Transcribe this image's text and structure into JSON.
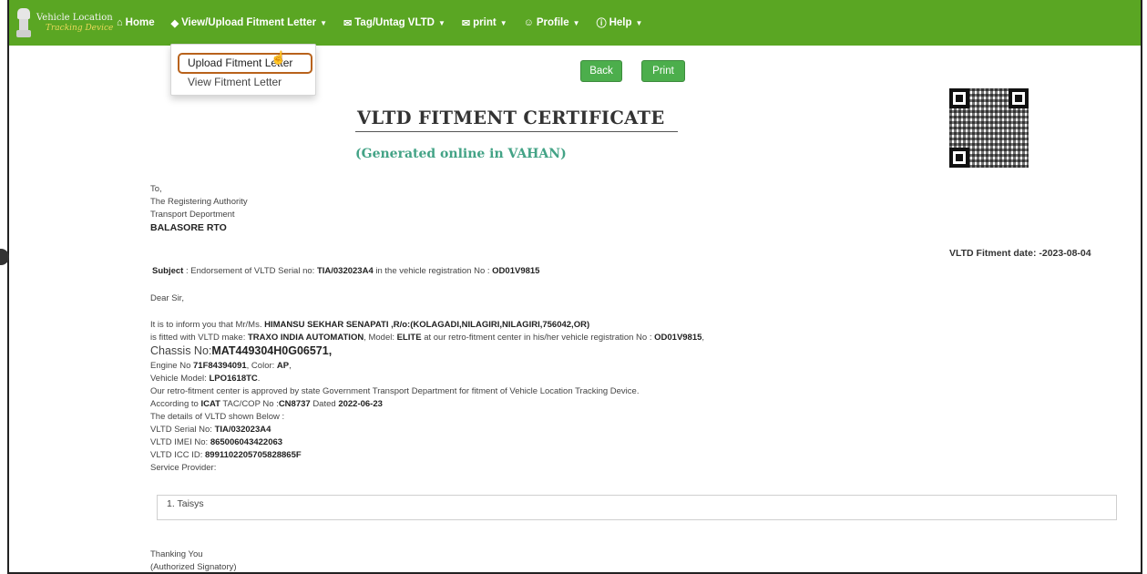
{
  "brand": {
    "line1": "Vehicle Location",
    "line2": "Tracking Device"
  },
  "nav": [
    {
      "label": "Home",
      "icon": "home-icon",
      "glyph": "⌂",
      "caret": false
    },
    {
      "label": "View/Upload Fitment Letter",
      "icon": "tags-icon",
      "glyph": "◆",
      "caret": true
    },
    {
      "label": "Tag/Untag VLTD",
      "icon": "link-icon",
      "glyph": "✉",
      "caret": true
    },
    {
      "label": "print",
      "icon": "paperclip-icon",
      "glyph": "✉",
      "caret": true
    },
    {
      "label": "Profile",
      "icon": "user-icon",
      "glyph": "☺",
      "caret": true
    },
    {
      "label": "Help",
      "icon": "info-icon",
      "glyph": "ⓘ",
      "caret": true
    }
  ],
  "dropdown": {
    "upload": "Upload Fitment Letter",
    "view": "View Fitment Letter"
  },
  "buttons": {
    "back": "Back",
    "print": "Print"
  },
  "doc": {
    "title": "VLTD FITMENT CERTIFICATE",
    "subtitle": "(Generated online in VAHAN)",
    "fitment_date": "VLTD Fitment date: -2023-08-04"
  },
  "address": {
    "to": "To,",
    "line1": "The Registering Authority",
    "line2": "Transport Deportment",
    "line3": "BALASORE RTO"
  },
  "subject": {
    "label": "Subject",
    "text1": ": Endorsement of VLTD Serial no:",
    "serial": "TIA/032023A4",
    "text2": "in the vehicle registration No :",
    "reg": "OD01V9815"
  },
  "salutation": "Dear Sir,",
  "body": {
    "inform_pre": "It is to inform you that Mr/Ms.",
    "owner": "HIMANSU SEKHAR SENAPATI ,R/o:(KOLAGADI,NILAGIRI,NILAGIRI,756042,OR)",
    "fitted_pre": "is fitted with VLTD make:",
    "make": "TRAXO INDIA AUTOMATION",
    "model_pre": ", Model:",
    "model": "ELITE",
    "fitted_mid": "at our retro-fitment center in his/her vehicle registration No :",
    "reg": "OD01V9815",
    "chassis_pre": "Chassis No:",
    "chassis": "MAT449304H0G06571,",
    "engine_pre": "Engine No",
    "engine": "71F84394091",
    "color_pre": ", Color:",
    "color": "AP",
    "vmodel_pre": "Vehicle Model:",
    "vmodel": "LPO1618TC",
    "approved": "Our retro-fitment center is approved by state Government Transport Department for fitment of Vehicle Location Tracking Device.",
    "icat_pre": "According to",
    "icat": "ICAT",
    "tac_pre": "TAC/COP No :",
    "tac": "CN8737",
    "dated_pre": "Dated",
    "dated": "2022-06-23",
    "details": "The details of VLTD shown Below :",
    "serial_pre": "VLTD Serial No:",
    "serial": "TIA/032023A4",
    "imei_pre": "VLTD IMEI No:",
    "imei": "865006043422063",
    "icc_pre": "VLTD ICC ID:",
    "icc": "8991102205705828865F",
    "sp_label": "Service Provider:",
    "sp_item": "1. Taisys"
  },
  "closing": {
    "thanks": "Thanking You",
    "sign": "(Authorized Signatory)"
  }
}
